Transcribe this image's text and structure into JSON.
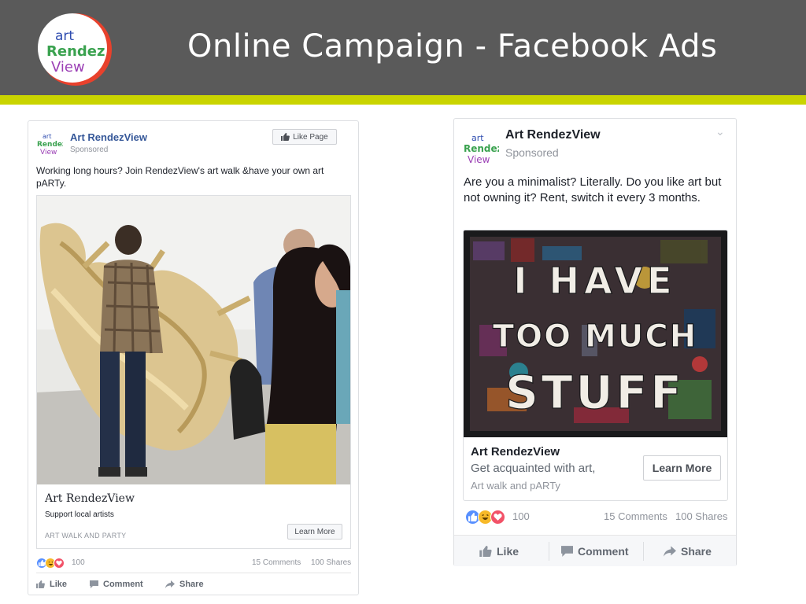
{
  "slide": {
    "title": "Online Campaign - Facebook Ads",
    "logo_text": [
      "art",
      "Rendez",
      "View"
    ]
  },
  "colors": {
    "header_bg": "#5a5a5a",
    "accent": "#c9d400",
    "fb_blue": "#365899",
    "like_blue": "#5890ff",
    "haha_yellow": "#f7b928",
    "love_red": "#f25268"
  },
  "ad1": {
    "page_name": "Art RendezView",
    "sponsored": "Sponsored",
    "like_page": "Like Page",
    "body": "Working long hours? Join RendezView's art walk &have your own art pARTy.",
    "link_title": "Art RendezView",
    "link_desc": "Support local artists",
    "link_caption": "ART WALK AND PARTY",
    "cta": "Learn More",
    "reaction_count": "100",
    "comments": "15 Comments",
    "shares": "100 Shares",
    "actions": {
      "like": "Like",
      "comment": "Comment",
      "share": "Share"
    }
  },
  "ad2": {
    "page_name": "Art RendezView",
    "sponsored": "Sponsored",
    "body": "Are you a minimalist? Literally. Do you like art but not owning it? Rent, switch it every 3 months.",
    "image_text": [
      "I HAVE",
      "TOO MUCH",
      "STUFF"
    ],
    "link_title": "Art RendezView",
    "link_desc": "Get acquainted with art,",
    "link_caption": "Art walk and pARTy",
    "cta": "Learn More",
    "reaction_count": "100",
    "comments": "15 Comments",
    "shares": "100 Shares",
    "actions": {
      "like": "Like",
      "comment": "Comment",
      "share": "Share"
    }
  }
}
